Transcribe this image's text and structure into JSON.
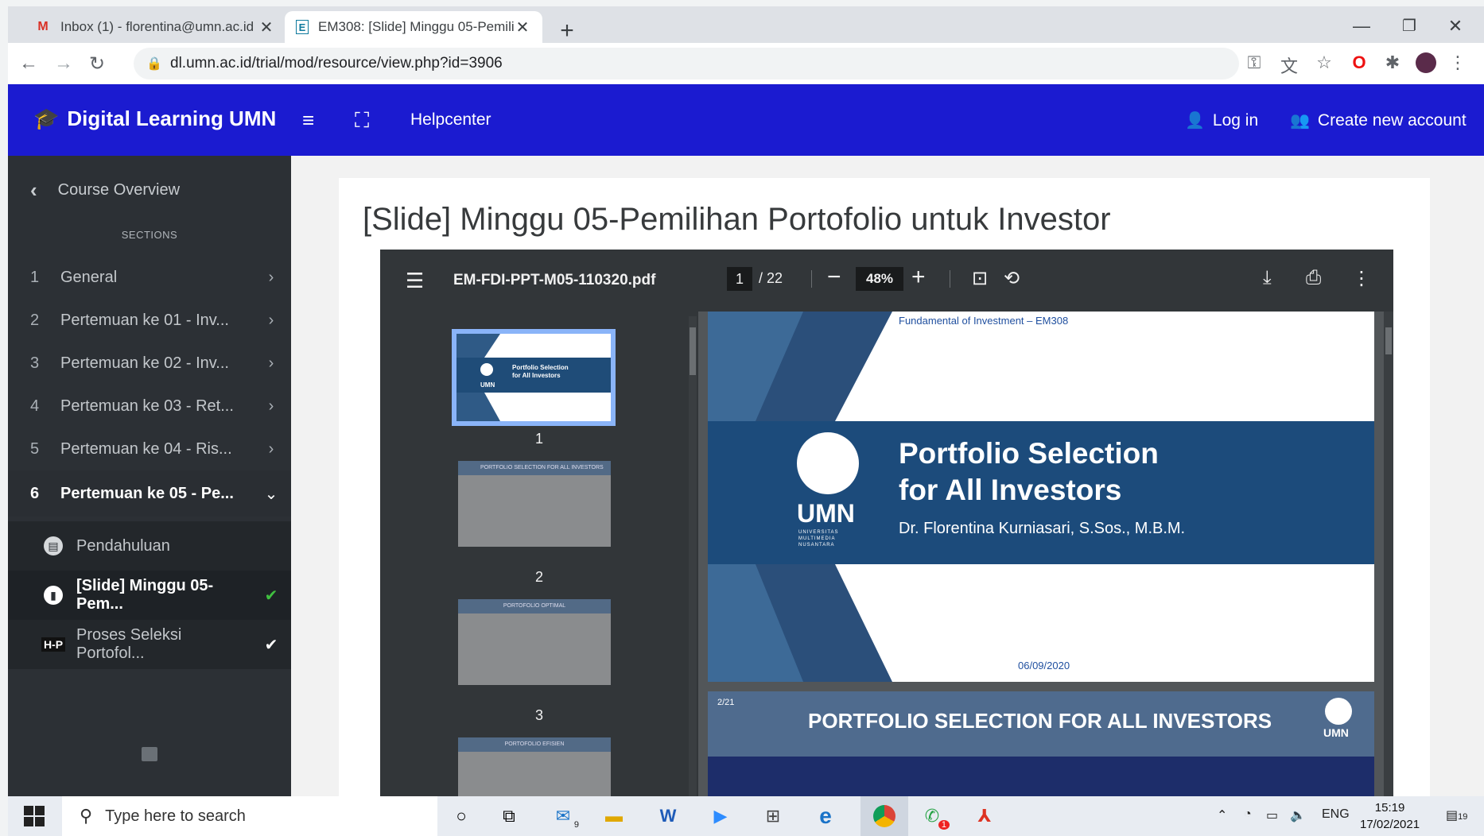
{
  "browser": {
    "tabs": [
      {
        "title": "Inbox (1) - florentina@umn.ac.id"
      },
      {
        "title": "EM308: [Slide] Minggu 05-Pemilihan Portofolio untuk Investor"
      }
    ],
    "url": "dl.umn.ac.id/trial/mod/resource/view.php?id=3906"
  },
  "header": {
    "brand": "Digital Learning UMN",
    "helpcenter": "Helpcenter",
    "login": "Log in",
    "signup": "Create new account"
  },
  "sidebar": {
    "back": "Course Overview",
    "sections_label": "SECTIONS",
    "sections": [
      {
        "num": "1",
        "label": "General"
      },
      {
        "num": "2",
        "label": "Pertemuan ke 01 - Inv..."
      },
      {
        "num": "3",
        "label": "Pertemuan ke 02 - Inv..."
      },
      {
        "num": "4",
        "label": "Pertemuan ke 03 - Ret..."
      },
      {
        "num": "5",
        "label": "Pertemuan ke 04 - Ris..."
      },
      {
        "num": "6",
        "label": "Pertemuan ke 05 - Pe..."
      }
    ],
    "activities": [
      {
        "label": "Pendahuluan"
      },
      {
        "label": "[Slide] Minggu 05-Pem..."
      },
      {
        "label": "Proses Seleksi Portofol...",
        "icon_text": "H-P"
      }
    ]
  },
  "page": {
    "title": "[Slide] Minggu 05-Pemilihan Portofolio untuk Investor"
  },
  "viewer": {
    "filename": "EM-FDI-PPT-M05-110320.pdf",
    "page_current": "1",
    "page_total": "/ 22",
    "zoom": "48%",
    "thumb_numbers": [
      "1",
      "2",
      "3"
    ],
    "slide1": {
      "course": "Fundamental of Investment – EM308",
      "title_line1": "Portfolio Selection",
      "title_line2": "for All Investors",
      "author": "Dr. Florentina Kurniasari, S.Sos., M.B.M.",
      "logo": "UMN",
      "logo_sub": "UNIVERSITAS MULTIMEDIA NUSANTARA",
      "date": "06/09/2020"
    },
    "slide2": {
      "page_label": "2/21",
      "heading": "PORTFOLIO SELECTION FOR ALL INVESTORS",
      "logo": "UMN"
    },
    "thumb_headings": [
      "PORTFOLIO SELECTION FOR ALL INVESTORS",
      "PORTOFOLIO OPTIMAL",
      "PORTOFOLIO EFISIEN"
    ]
  },
  "taskbar": {
    "search_placeholder": "Type here to search",
    "mail_badge": "9",
    "whatsapp_badge": "1",
    "lang": "ENG",
    "time": "15:19",
    "date": "17/02/2021",
    "notif_badge": "19"
  }
}
